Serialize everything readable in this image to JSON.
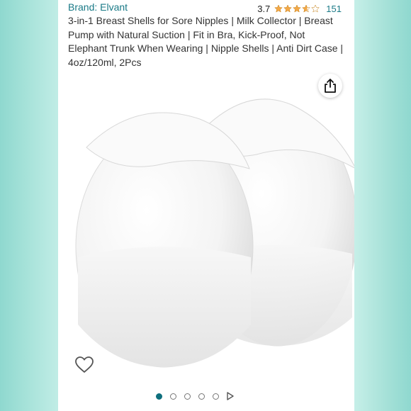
{
  "product": {
    "brand": "Brand: Elvant",
    "rating_value": "3.7",
    "rating_stars": 3.7,
    "rating_count": "151",
    "title": "3-in-1 Breast Shells for Sore Nipples | Milk Collector | Breast Pump with Natural Suction | Fit in Bra, Kick-Proof, Not Elephant Trunk When Wearing | Nipple Shells | Anti Dirt Case | 4oz/120ml, 2Pcs"
  },
  "gallery": {
    "image_count": 5,
    "active_index": 0,
    "has_video": true
  },
  "icons": {
    "share": "share-icon",
    "favorite": "heart-icon",
    "video": "play-icon"
  },
  "colors": {
    "link": "#1a7a87",
    "star": "#f3a847",
    "active_dot": "#0e6f7d",
    "background": "#bfece5"
  }
}
